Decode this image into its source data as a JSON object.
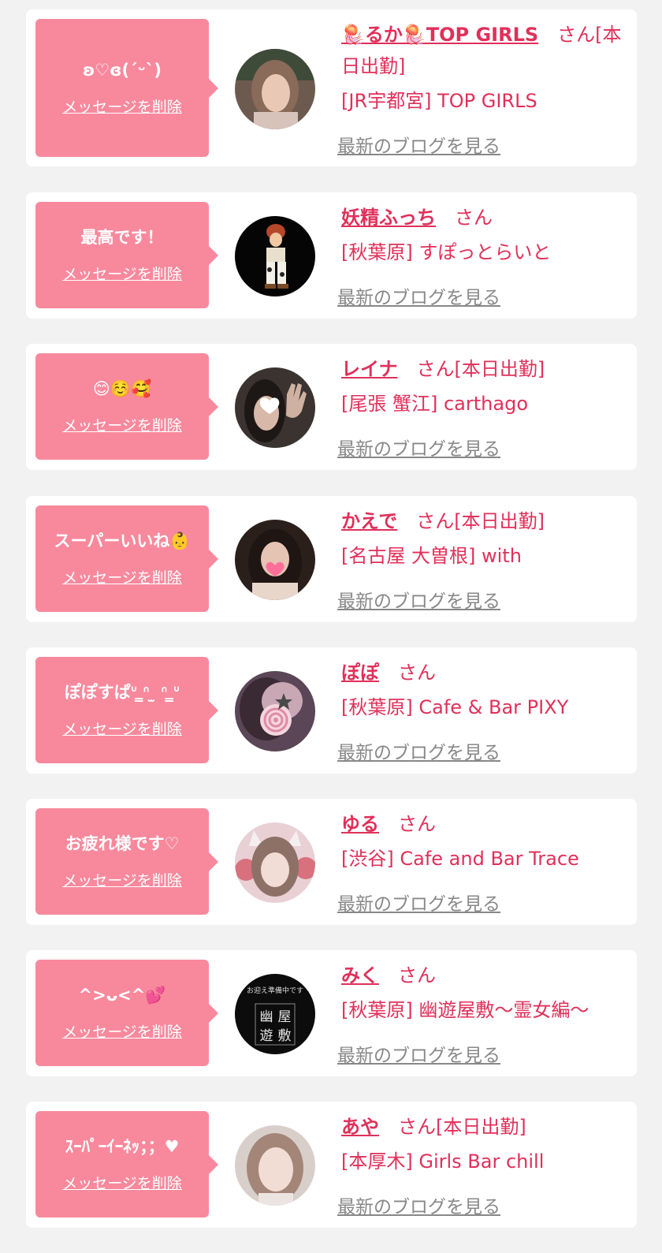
{
  "items": [
    {
      "message": "ʚ♡ɞ(ˊᵕˋ)",
      "delete_label": "メッセージを削除",
      "name": "🪼るか🪼TOP GIRLS",
      "honorific": "さん[本日出勤]",
      "shop": "[JR宇都宮] TOP GIRLS",
      "blog_label": "最新のブログを見る"
    },
    {
      "message": "最高です！",
      "delete_label": "メッセージを削除",
      "name": "妖精ふっち",
      "honorific": "さん",
      "shop": "[秋葉原] すぽっとらいと",
      "blog_label": "最新のブログを見る"
    },
    {
      "message": "😊☺️🥰",
      "delete_label": "メッセージを削除",
      "name": "レイナ",
      "honorific": "さん[本日出勤]",
      "shop": "[尾張 蟹江] carthago",
      "blog_label": "最新のブログを見る"
    },
    {
      "message": "スーパーいいね👶",
      "delete_label": "メッセージを削除",
      "name": "かえで",
      "honorific": "さん[本日出勤]",
      "shop": "[名古屋 大曽根] with",
      "blog_label": "最新のブログを見る"
    },
    {
      "message": "ぽぽすぱᐡ ̳ᐢ ̫ ᐢ ̳ᐡ",
      "delete_label": "メッセージを削除",
      "name": "ぽぽ",
      "honorific": "さん",
      "shop": "[秋葉原] Cafe & Bar PIXY",
      "blog_label": "最新のブログを見る"
    },
    {
      "message": "お疲れ様です♡",
      "delete_label": "メッセージを削除",
      "name": "ゆる",
      "honorific": "さん",
      "shop": "[渋谷] Cafe and Bar Trace",
      "blog_label": "最新のブログを見る"
    },
    {
      "message": "^>ᴗ<^💕",
      "delete_label": "メッセージを削除",
      "name": "みく",
      "honorific": "さん",
      "shop": "[秋葉原] 幽遊屋敷〜霊女編〜",
      "blog_label": "最新のブログを見る"
    },
    {
      "message": "ｽｰﾊﾟｰｲｰﾈｯ；；♥",
      "delete_label": "メッセージを削除",
      "name": "あや",
      "honorific": "さん[本日出勤]",
      "shop": "[本厚木] Girls Bar chill",
      "blog_label": "最新のブログを見る"
    }
  ],
  "avatar_seals": [
    "お迎え準備中です",
    "幽",
    "屋",
    "遊",
    "敷"
  ]
}
